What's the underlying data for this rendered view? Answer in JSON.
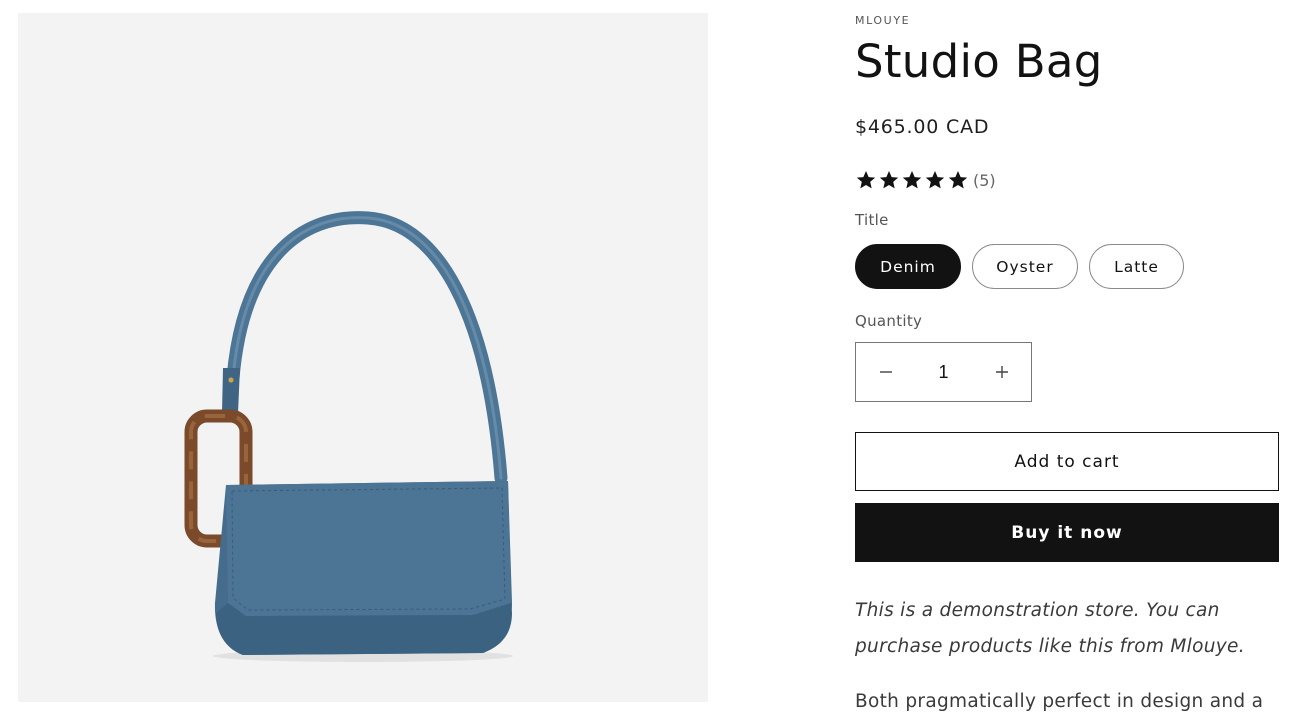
{
  "product": {
    "vendor": "MLOUYE",
    "title": "Studio Bag",
    "price": "$465.00 CAD",
    "rating": {
      "stars": 5,
      "max_stars": 5,
      "count_label": "(5)"
    },
    "image_alt": "Studio Bag in Denim"
  },
  "options": {
    "label": "Title",
    "values": [
      "Denim",
      "Oyster",
      "Latte"
    ],
    "selected": "Denim"
  },
  "quantity": {
    "label": "Quantity",
    "value": "1",
    "decrease_icon": "minus-icon",
    "increase_icon": "plus-icon"
  },
  "buttons": {
    "add_to_cart": "Add to cart",
    "buy_now": "Buy it now"
  },
  "description": {
    "note": "This is a demonstration store. You can purchase products like this from Mlouye.",
    "body_start": "Both pragmatically perfect in design and a"
  },
  "colors": {
    "text": "#121212",
    "media_bg": "#f3f3f3",
    "bag_blue": "#456c8c",
    "handle_tortoise": "#7a4a2a"
  }
}
